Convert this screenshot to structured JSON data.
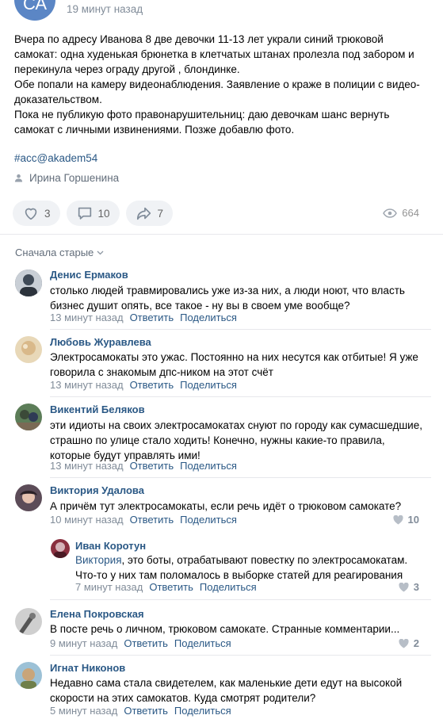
{
  "post": {
    "avatar_initials": "СА",
    "time": "19 минут назад",
    "text_lines": [
      "Вчера по адресу Иванова 8 две девочки 11-13 лет украли синий трюковой",
      "самокат: одна худенькая брюнетка в клетчатых штанах пролезла под забором и",
      "перекинула через ограду другой , блондинке.",
      "Обе попали на камеру видеонаблюдения. Заявление о краже в полиции с видео-",
      "доказательством.",
      "Пока не публикую фото правонарушительниц: даю девочкам шанс вернуть",
      "самокат с личными извинениями. Позже добавлю фото."
    ],
    "hashtag": "#acc@akadem54",
    "author": "Ирина Горшенина",
    "likes": "3",
    "comments": "10",
    "shares": "7",
    "views": "664"
  },
  "sort_label": "Сначала старые",
  "comment_actions": {
    "reply": "Ответить",
    "share": "Поделиться"
  },
  "comments": [
    {
      "name": "Денис Ермаков",
      "lines": [
        "столько людей травмировались уже из-за них, а люди ноют, что власть",
        "бизнес душит опять, все такое - ну вы в своем уме вообще?"
      ],
      "time": "13 минут назад",
      "avatar_color": "#3f4a57"
    },
    {
      "name": "Любовь Журавлева",
      "lines": [
        "Электросамокаты это ужас. Постоянно на них несутся как отбитые! Я уже",
        "говорила с знакомым дпс-ником на этот счёт"
      ],
      "time": "13 минут назад",
      "avatar_color": "#d9b98a"
    },
    {
      "name": "Викентий Беляков",
      "lines": [
        "эти идиоты на своих электросамокатах снуют по городу как сумасшедшие,",
        "страшно по улице стало ходить! Конечно, нужны какие-то правила,",
        "которые будут управлять ими!"
      ],
      "time": "13 минут назад",
      "avatar_color": "#4e6b4a"
    },
    {
      "name": "Виктория Удалова",
      "lines": [
        "А причём тут электросамокаты, если речь идёт о трюковом самокате?"
      ],
      "time": "10 минут назад",
      "likes": "10",
      "avatar_color": "#6a5a66"
    },
    {
      "name": "Иван Коротун",
      "reply_to": "Виктория",
      "lines": [
        ", это боты, отрабатывают повестку по электросамокатам.",
        "Что-то у них там поломалось в выборке статей для реагирования"
      ],
      "time": "7 минут назад",
      "likes": "3",
      "avatar_color": "#8a2f3f"
    },
    {
      "name": "Елена Покровская",
      "lines": [
        "В посте речь о личном, трюковом самокате. Странные комментарии..."
      ],
      "time": "9 минут назад",
      "likes": "2",
      "avatar_color": "#7a7a7a"
    },
    {
      "name": "Игнат Никонов",
      "lines": [
        "Недавно сама стала свидетелем, как маленькие дети едут на высокой",
        "скорости на этих самокатов. Куда смотрят родители?"
      ],
      "time": "5 минут назад",
      "avatar_color": "#b99a6a"
    }
  ]
}
